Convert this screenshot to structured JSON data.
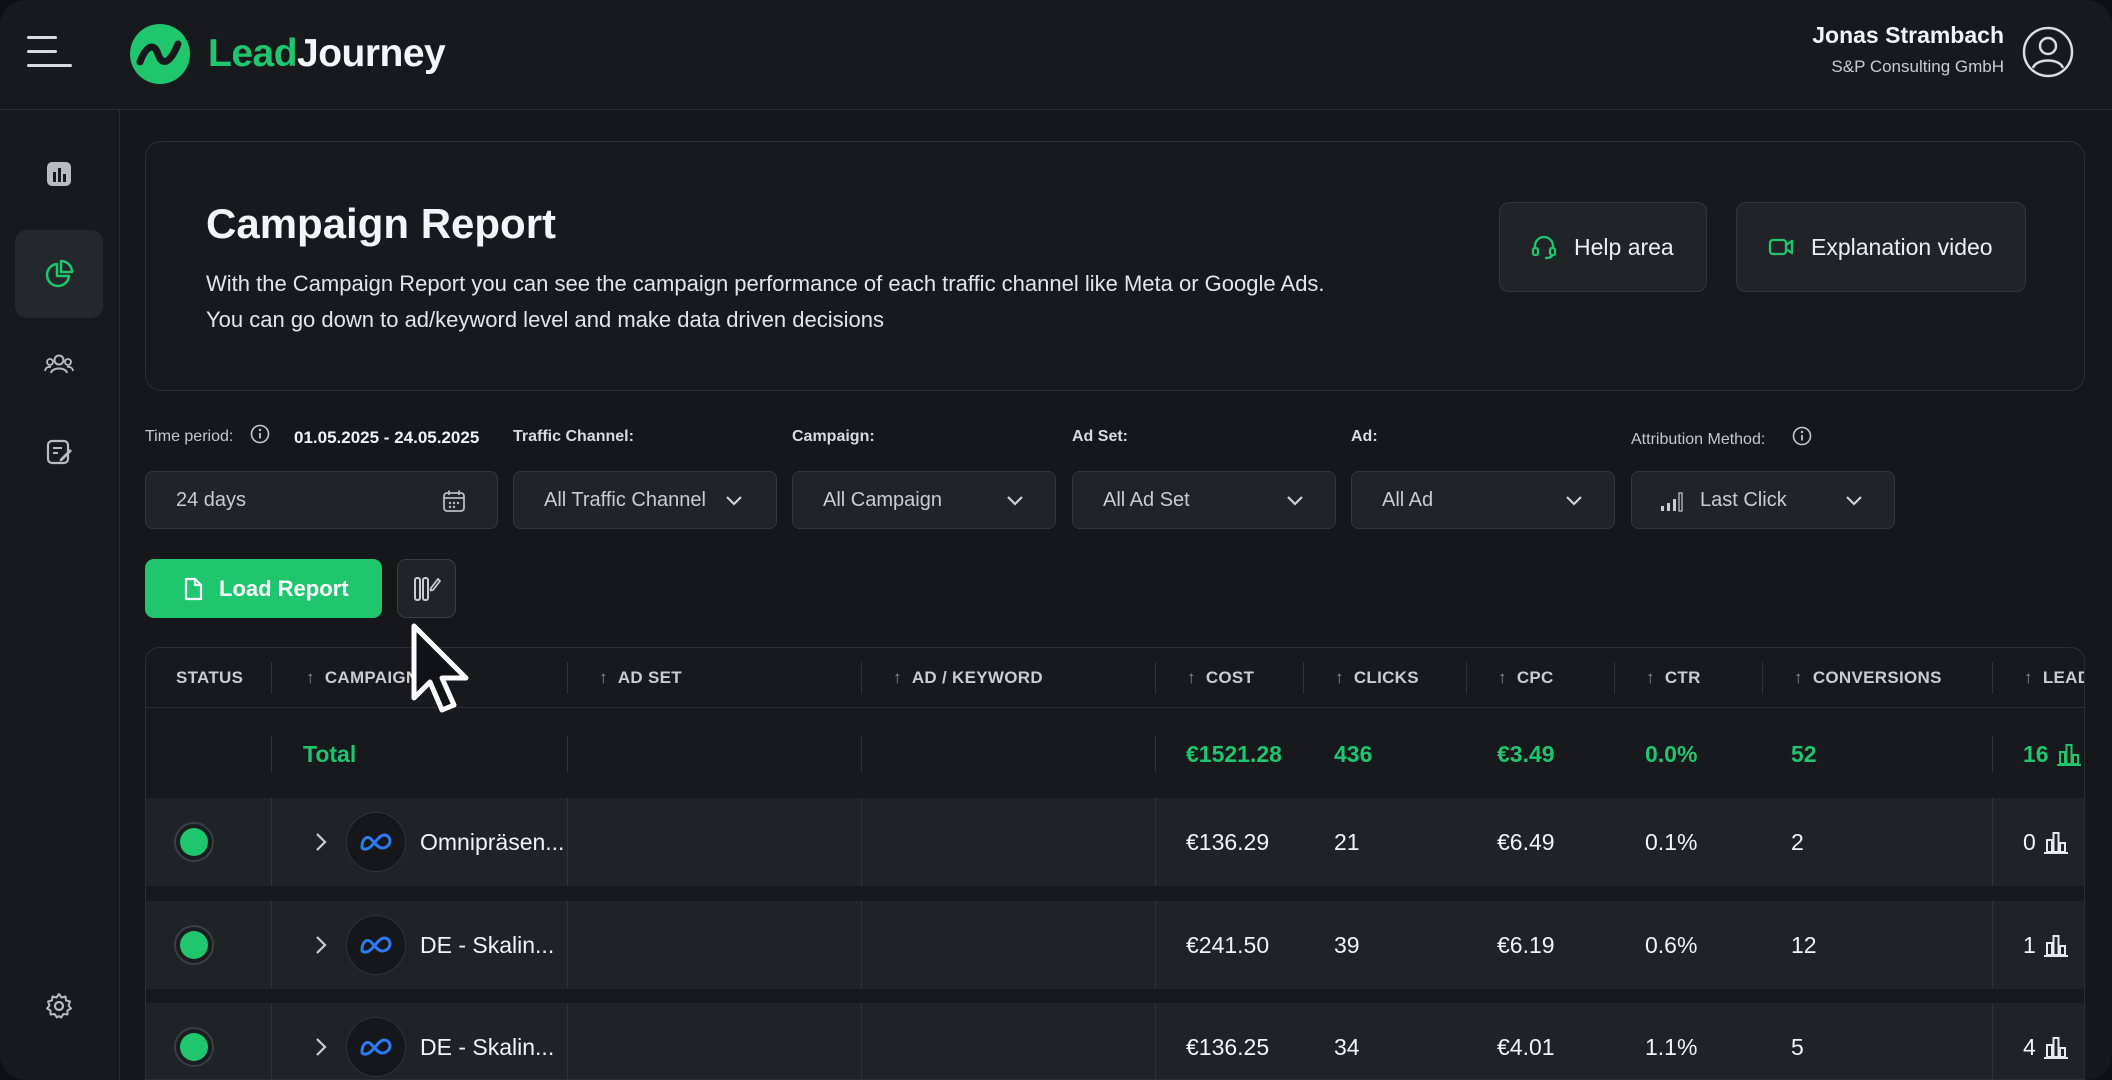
{
  "app": {
    "logo_part1": "Lead",
    "logo_part2": "Journey",
    "brand_color": "#1fc66e"
  },
  "user": {
    "name": "Jonas Strambach",
    "company": "S&P Consulting GmbH"
  },
  "sidebar": {
    "items": [
      {
        "icon": "bar-chart-icon",
        "active": false
      },
      {
        "icon": "pie-chart-icon",
        "active": true
      },
      {
        "icon": "users-icon",
        "active": false
      },
      {
        "icon": "edit-document-icon",
        "active": false
      },
      {
        "icon": "gear-icon",
        "active": false
      }
    ]
  },
  "hero": {
    "title": "Campaign Report",
    "desc_line1": "With the Campaign Report you can see the campaign performance of each traffic channel like Meta or Google Ads.",
    "desc_line2": "You can go down to ad/keyword level and make data driven decisions",
    "help_label": "Help area",
    "video_label": "Explanation video"
  },
  "filters": {
    "time_period_label": "Time period:",
    "time_period_value": "01.05.2025 - 24.05.2025",
    "time_period_box": "24 days",
    "traffic_channel_label": "Traffic Channel:",
    "traffic_channel_value": "All Traffic Channel",
    "campaign_label": "Campaign:",
    "campaign_value": "All Campaign",
    "ad_set_label": "Ad Set:",
    "ad_set_value": "All Ad Set",
    "ad_label": "Ad:",
    "ad_value": "All Ad",
    "attribution_label": "Attribution Method:",
    "attribution_value": "Last Click"
  },
  "actions": {
    "load_report": "Load Report"
  },
  "table": {
    "headers": {
      "status": "STATUS",
      "campaign": "CAMPAIGN",
      "ad_set": "AD SET",
      "ad_keyword": "AD / KEYWORD",
      "cost": "COST",
      "clicks": "CLICKS",
      "cpc": "CPC",
      "ctr": "CTR",
      "conversions": "CONVERSIONS",
      "leads": "LEADS"
    },
    "sort_arrow": "↑",
    "total": {
      "label": "Total",
      "cost": "€1521.28",
      "clicks": "436",
      "cpc": "€3.49",
      "ctr": "0.0%",
      "conversions": "52",
      "leads": "16"
    },
    "rows": [
      {
        "campaign": "Omnipräsen...",
        "cost": "€136.29",
        "clicks": "21",
        "cpc": "€6.49",
        "ctr": "0.1%",
        "conversions": "2",
        "leads": "0"
      },
      {
        "campaign": "DE - Skalin...",
        "cost": "€241.50",
        "clicks": "39",
        "cpc": "€6.19",
        "ctr": "0.6%",
        "conversions": "12",
        "leads": "1"
      },
      {
        "campaign": "DE - Skalin...",
        "cost": "€136.25",
        "clicks": "34",
        "cpc": "€4.01",
        "ctr": "1.1%",
        "conversions": "5",
        "leads": "4"
      }
    ]
  }
}
